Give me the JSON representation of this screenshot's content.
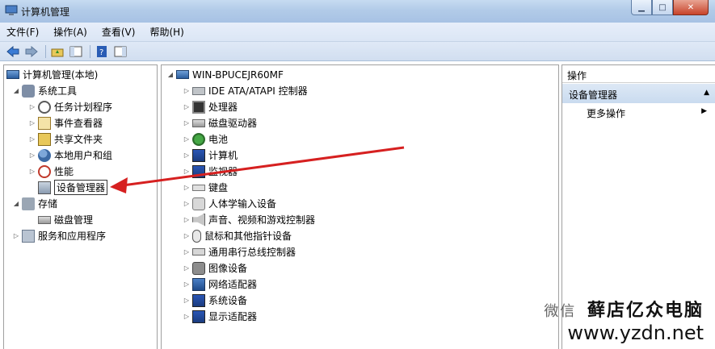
{
  "window": {
    "title": "计算机管理"
  },
  "menubar": [
    {
      "label": "文件(F)"
    },
    {
      "label": "操作(A)"
    },
    {
      "label": "查看(V)"
    },
    {
      "label": "帮助(H)"
    }
  ],
  "left_tree": {
    "root": "计算机管理(本地)",
    "system_tools": "系统工具",
    "system_tools_children": [
      {
        "label": "任务计划程序",
        "icon": "clock-icon"
      },
      {
        "label": "事件查看器",
        "icon": "event-viewer-icon"
      },
      {
        "label": "共享文件夹",
        "icon": "shared-folder-icon"
      },
      {
        "label": "本地用户和组",
        "icon": "users-icon"
      },
      {
        "label": "性能",
        "icon": "performance-icon"
      },
      {
        "label": "设备管理器",
        "icon": "device-manager-icon",
        "selected": true
      }
    ],
    "storage": "存储",
    "storage_children": [
      {
        "label": "磁盘管理",
        "icon": "disk-icon"
      }
    ],
    "services": "服务和应用程序"
  },
  "device_tree": {
    "root": "WIN-BPUCEJR60MF",
    "categories": [
      {
        "label": "IDE ATA/ATAPI 控制器",
        "icon": "ide-controller-icon"
      },
      {
        "label": "处理器",
        "icon": "processor-icon"
      },
      {
        "label": "磁盘驱动器",
        "icon": "disk-drive-icon"
      },
      {
        "label": "电池",
        "icon": "battery-icon"
      },
      {
        "label": "计算机",
        "icon": "computer-icon"
      },
      {
        "label": "监视器",
        "icon": "monitor-icon"
      },
      {
        "label": "键盘",
        "icon": "keyboard-icon"
      },
      {
        "label": "人体学输入设备",
        "icon": "hid-icon"
      },
      {
        "label": "声音、视频和游戏控制器",
        "icon": "sound-icon"
      },
      {
        "label": "鼠标和其他指针设备",
        "icon": "mouse-icon"
      },
      {
        "label": "通用串行总线控制器",
        "icon": "usb-icon"
      },
      {
        "label": "图像设备",
        "icon": "imaging-icon"
      },
      {
        "label": "网络适配器",
        "icon": "network-adapter-icon"
      },
      {
        "label": "系统设备",
        "icon": "system-device-icon"
      },
      {
        "label": "显示适配器",
        "icon": "display-adapter-icon"
      }
    ]
  },
  "actions_pane": {
    "header": "操作",
    "group": "设备管理器",
    "more": "更多操作"
  },
  "watermark": {
    "weixin": "微信",
    "brand": "藓店亿众电脑",
    "url": "www.yzdn.net"
  },
  "colors": {
    "annotation_arrow": "#d62020"
  }
}
